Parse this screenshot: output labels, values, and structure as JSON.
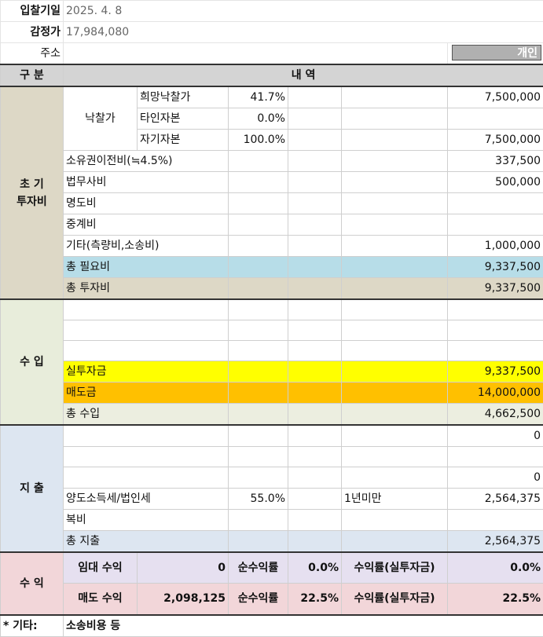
{
  "header": {
    "bid_date_label": "입찰기일",
    "bid_date_value": "2025. 4. 8",
    "appraisal_label": "감정가",
    "appraisal_value": "17,984,080",
    "address_label": "주소",
    "owner_type": "개인"
  },
  "table_head": {
    "category": "구 분",
    "detail": "내 역"
  },
  "initial": {
    "section_label_1": "초 기",
    "section_label_2": "투자비",
    "bid_price_label": "낙찰가",
    "desired_bid": {
      "label": "희망낙찰가",
      "rate": "41.7%",
      "amount": "7,500,000"
    },
    "other_capital": {
      "label": "타인자본",
      "rate": "0.0%",
      "amount": ""
    },
    "own_capital": {
      "label": "자기자본",
      "rate": "100.0%",
      "amount": "7,500,000"
    },
    "transfer_cost": {
      "label": "소유권이전비(≒4.5%)",
      "amount": "337,500"
    },
    "legal_fee": {
      "label": "법무사비",
      "amount": "500,000"
    },
    "eviction": {
      "label": "명도비",
      "amount": ""
    },
    "brokerage": {
      "label": "중계비",
      "amount": ""
    },
    "other": {
      "label": "기타(측량비,소송비)",
      "amount": "1,000,000"
    },
    "total_required": {
      "label": "총 필요비",
      "amount": "9,337,500"
    },
    "total_invest": {
      "label": "총 투자비",
      "amount": "9,337,500"
    }
  },
  "income": {
    "section_label": "수 입",
    "actual_invest": {
      "label": "실투자금",
      "amount": "9,337,500"
    },
    "sale_price": {
      "label": "매도금",
      "amount": "14,000,000"
    },
    "total_income": {
      "label": "총 수입",
      "amount": "4,662,500"
    }
  },
  "expense": {
    "section_label": "지 출",
    "blank1_amount": "0",
    "blank3_amount": "0",
    "tax": {
      "label": "양도소득세/법인세",
      "rate": "55.0%",
      "period": "1년미만",
      "amount": "2,564,375"
    },
    "misc": {
      "label": "복비",
      "amount": ""
    },
    "total_expense": {
      "label": "총 지출",
      "amount": "2,564,375"
    }
  },
  "profit": {
    "section_label": "수 익",
    "rent": {
      "label": "임대 수익",
      "amount": "0",
      "net_label": "순수익률",
      "net_rate": "0.0%",
      "roi_label": "수익률(실투자금)",
      "roi": "0.0%"
    },
    "sale": {
      "label": "매도 수익",
      "amount": "2,098,125",
      "net_label": "순수익률",
      "net_rate": "22.5%",
      "roi_label": "수익률(실투자금)",
      "roi": "22.5%"
    }
  },
  "footer": {
    "label": "* 기타:",
    "value": "소송비용 등"
  }
}
